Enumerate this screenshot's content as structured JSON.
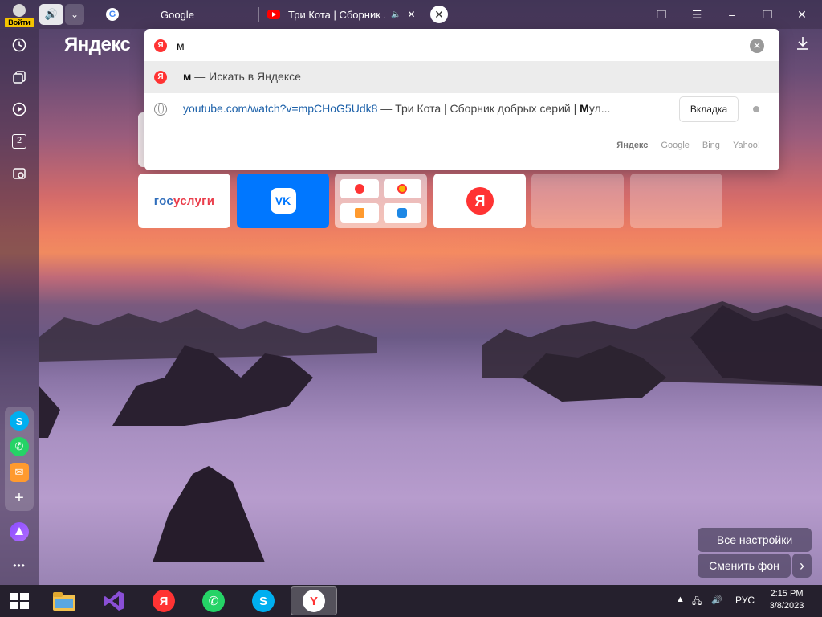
{
  "browser": {
    "login_label": "Войти",
    "tabs": [
      {
        "title": "Google",
        "icon": "google-icon"
      },
      {
        "title": "Три Кота | Сборник ...",
        "icon": "youtube-icon",
        "audio": true
      }
    ],
    "close_tab_glyph": "✕"
  },
  "sidebar": {
    "items": [
      "history-icon",
      "collections-icon",
      "video-icon",
      "tab-count-icon",
      "screenshot-icon"
    ],
    "tab_count": "2",
    "apps": [
      "skype-icon",
      "whatsapp-icon",
      "mail-icon",
      "add-app-icon"
    ],
    "more_label": "•••"
  },
  "logo": "Яндекс",
  "omnibox": {
    "query": "м",
    "suggestions": [
      {
        "bold": "м",
        "rest": " — Искать в Яндексе",
        "type": "search"
      },
      {
        "url": "youtube.com/watch?v=mpCHoG5Udk8",
        "rest": " — Три Кота | Сборник добрых серий | ",
        "bold": "М",
        "tail": "ул...",
        "type": "tab",
        "action": "Вкладка"
      }
    ],
    "engines": [
      "Яндекс",
      "Google",
      "Bing",
      "Yahoo!"
    ]
  },
  "tiles": {
    "gosuslugi_a": "гос",
    "gosuslugi_b": "услуги",
    "vk": "VK",
    "yandex": "Я"
  },
  "bottom_buttons": {
    "all_settings": "Все настройки",
    "change_bg": "Сменить фон",
    "next_glyph": "›"
  },
  "taskbar": {
    "language": "РУС",
    "time": "2:15 PM",
    "date": "3/8/2023",
    "apps": [
      "file-explorer",
      "visual-studio",
      "yandex-browser",
      "whatsapp",
      "skype",
      "yandex-browser-active"
    ]
  },
  "colors": {
    "yandex_red": "#ff3333",
    "vk_blue": "#0077ff",
    "login_yellow": "#f5c400"
  }
}
